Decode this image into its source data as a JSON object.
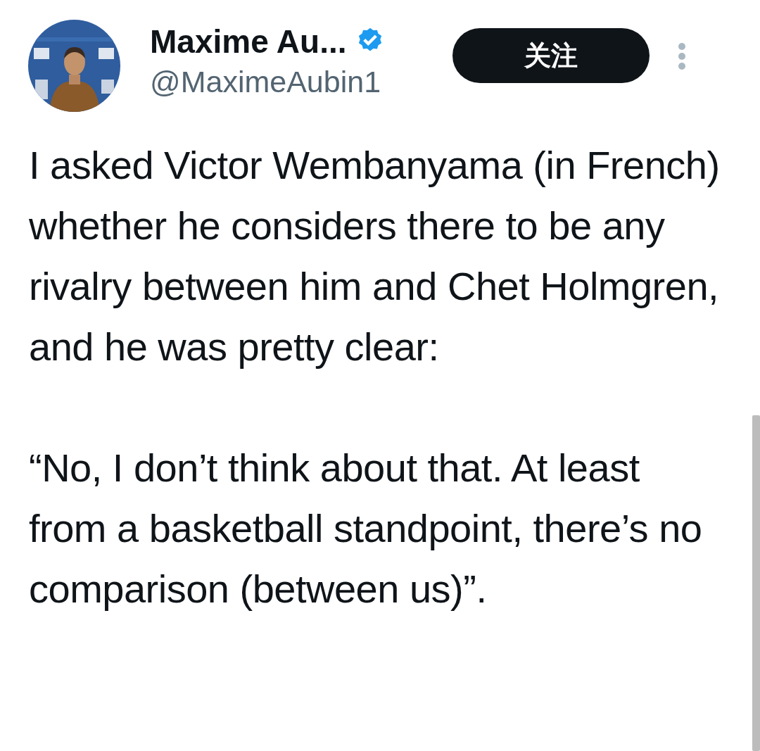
{
  "author": {
    "name": "Maxime Au...",
    "handle": "@MaximeAubin1",
    "verified": true
  },
  "follow_button": {
    "label": "关注"
  },
  "tweet": {
    "paragraphs": [
      "I asked Victor Wembanyama (in French) whether he considers there to be any rivalry between him and Chet Holmgren, and he was pretty clear:",
      "“No, I don’t think about that. At least from a basketball standpoint, there’s no comparison (between us)”."
    ]
  }
}
